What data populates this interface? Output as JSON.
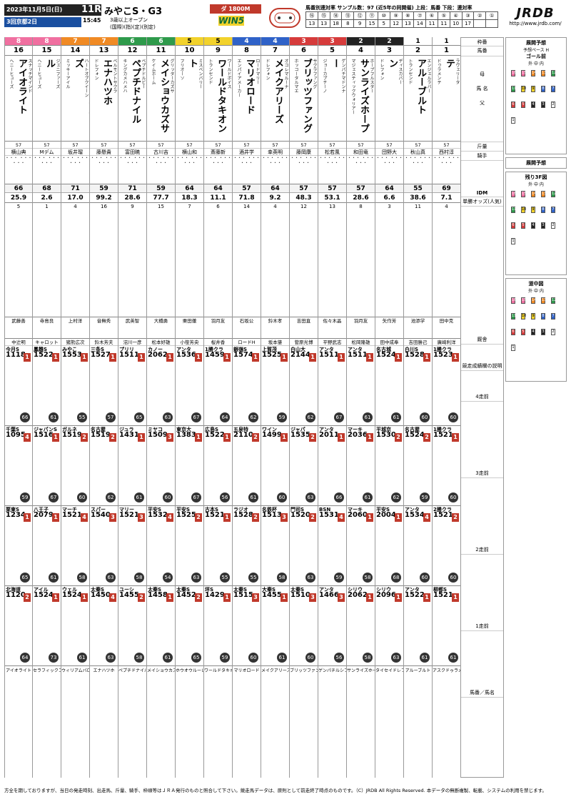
{
  "header": {
    "date": "2023年11月5日(日)",
    "race_num": "11R",
    "race_name": "みやこS・G3",
    "meeting": "3回京都2日",
    "time": "15:45",
    "cond1": "3歳以上オープン",
    "cond2": "(国際)(指)(定)(別定)",
    "course": "ダ 1800M",
    "win5": "WIN5",
    "stats": "馬番別連対率 サンプル数：97 (近5年の同開催) 上段：馬番 下段：連対率",
    "num_row": [
      "⑯",
      "⑮",
      "⑭",
      "⑬",
      "⑫",
      "⑪",
      "⑩",
      "⑨",
      "⑧",
      "⑦",
      "⑥",
      "⑤",
      "④",
      "③",
      "②",
      "①"
    ],
    "rate_row": [
      "13",
      "13",
      "18",
      "8",
      "9",
      "15",
      "5",
      "12",
      "13",
      "14",
      "11",
      "11",
      "10",
      "17",
      "",
      ""
    ],
    "logo": "JRDB",
    "url": "http://www.jrdb.com/"
  },
  "horses": [
    {
      "waku": "8",
      "umaban": "16",
      "name": "アイオライト",
      "sire": "ヘニーヒューズ",
      "dam": "スナッチマインド",
      "jockey": "横山典",
      "weight": "57",
      "idx": "66",
      "odds": "25.9",
      "pop": "5",
      "trainer": "武藤善",
      "owner": "中辻明",
      "past": [
        {
          "t": "今月S",
          "r": "1118",
          "pos": "1",
          "idm": "66"
        },
        {
          "t": "千葉S",
          "r": "1095",
          "pos": "4",
          "idm": "59"
        },
        {
          "t": "栗東S",
          "r": "1234",
          "pos": "1",
          "idm": "65"
        },
        {
          "t": "北海道",
          "r": "1120",
          "pos": "2",
          "idm": "64"
        }
      ]
    },
    {
      "waku": "8",
      "umaban": "15",
      "name": "セラフィックコール",
      "sire": "ヘニーヒューズ",
      "dam": "ジェニファーズ",
      "jockey": "Mデム",
      "weight": "57",
      "idx": "68",
      "odds": "2.6",
      "pop": "1",
      "trainer": "寺島良",
      "owner": "キャロット",
      "past": [
        {
          "t": "鳳雛S",
          "r": "1522",
          "pos": "1",
          "idm": "61"
        },
        {
          "t": "ジャパンS",
          "r": "1516",
          "pos": "1",
          "idm": "67"
        },
        {
          "t": "八王子",
          "r": "2079",
          "pos": "1",
          "idm": "61"
        },
        {
          "t": "アイル",
          "r": "1524",
          "pos": "1",
          "idm": "73"
        }
      ]
    },
    {
      "waku": "7",
      "umaban": "14",
      "name": "ウィリアムバローズ",
      "sire": "ミッキーアイル",
      "dam": "ハートオブクイーン",
      "jockey": "坂井瑠",
      "weight": "57",
      "idx": "71",
      "odds": "17.0",
      "pop": "4",
      "trainer": "上村洋",
      "owner": "猪熊広次",
      "past": [
        {
          "t": "みやこ",
          "r": "1553",
          "pos": "1",
          "idm": "55"
        },
        {
          "t": "ガルネ",
          "r": "1519",
          "pos": "2",
          "idm": "60"
        },
        {
          "t": "マーチ",
          "r": "1521",
          "pos": "4",
          "idm": "58"
        },
        {
          "t": "ウェル",
          "r": "1524",
          "pos": "1",
          "idm": "61"
        }
      ]
    },
    {
      "waku": "7",
      "umaban": "13",
      "name": "エナハツホ",
      "sire": "ドレフォン",
      "dam": "ベルモントサクラ",
      "jockey": "藤懸貴",
      "weight": "57",
      "idx": "59",
      "odds": "99.2",
      "pop": "16",
      "trainer": "音無秀",
      "owner": "鈴木芳夫",
      "past": [
        {
          "t": "三条S",
          "r": "1527",
          "pos": "1",
          "idm": "57"
        },
        {
          "t": "名古屋",
          "r": "1519",
          "pos": "2",
          "idm": "62"
        },
        {
          "t": "スパー",
          "r": "1540",
          "pos": "3",
          "idm": "63"
        },
        {
          "t": "太秦S",
          "r": "1450",
          "pos": "4",
          "idm": "63"
        }
      ]
    },
    {
      "waku": "6",
      "umaban": "12",
      "name": "ペプチドナイル",
      "sire": "キングカメハメハ",
      "dam": "ペプチドルビー",
      "jockey": "富田暁",
      "weight": "57",
      "idx": "71",
      "odds": "28.6",
      "pop": "9",
      "trainer": "武英智",
      "owner": "沼川一彦",
      "past": [
        {
          "t": "プリリ",
          "r": "1511",
          "pos": "1",
          "idm": "65"
        },
        {
          "t": "ジュラ",
          "r": "1431",
          "pos": "1",
          "idm": "61"
        },
        {
          "t": "マリー",
          "r": "1521",
          "pos": "3",
          "idm": "58"
        },
        {
          "t": "ユーシ",
          "r": "1455",
          "pos": "2",
          "idm": "58"
        }
      ]
    },
    {
      "waku": "6",
      "umaban": "11",
      "name": "メイショウカズサ",
      "sire": "ケイムホーム",
      "dam": "グリッターカズサ",
      "jockey": "古川吉",
      "weight": "57",
      "idx": "59",
      "odds": "77.7",
      "pop": "15",
      "trainer": "大橋勇",
      "owner": "松本好雄",
      "past": [
        {
          "t": "カノー",
          "r": "2062",
          "pos": "1",
          "idm": "63"
        },
        {
          "t": "ミヤコ",
          "r": "1509",
          "pos": "3",
          "idm": "60"
        },
        {
          "t": "平安S",
          "r": "1532",
          "pos": "4",
          "idm": "54"
        },
        {
          "t": "太秦S",
          "r": "1458",
          "pos": "1",
          "idm": "61"
        }
      ]
    },
    {
      "waku": "5",
      "umaban": "10",
      "name": "ホウオウルーレット",
      "sire": "フリオーソ",
      "dam": "ミスペンバリー",
      "jockey": "横山和",
      "weight": "57",
      "idx": "64",
      "odds": "18.3",
      "pop": "7",
      "trainer": "栗田徹",
      "owner": "小笹芳央",
      "past": [
        {
          "t": "アンタ",
          "r": "1536",
          "pos": "1",
          "idm": "67"
        },
        {
          "t": "東京大",
          "r": "1383",
          "pos": "1",
          "idm": "67"
        },
        {
          "t": "平安S",
          "r": "1525",
          "pos": "2",
          "idm": "63"
        },
        {
          "t": "太秦S",
          "r": "1452",
          "pos": "2",
          "idm": "65"
        }
      ]
    },
    {
      "waku": "5",
      "umaban": "9",
      "name": "ワールドタキオン",
      "sire": "トランセンド",
      "dam": "ワールドボイス",
      "jockey": "斎藤新",
      "weight": "57",
      "idx": "64",
      "odds": "11.1",
      "pop": "6",
      "trainer": "羽月友",
      "owner": "桜井香",
      "past": [
        {
          "t": "1勝クラ",
          "r": "1459",
          "pos": "1",
          "idm": "64"
        },
        {
          "t": "広島S",
          "r": "1522",
          "pos": "1",
          "idm": "56"
        },
        {
          "t": "古本S",
          "r": "1521",
          "pos": "1",
          "idm": "55"
        },
        {
          "t": "坪S",
          "r": "1429",
          "pos": "1",
          "idm": "59"
        }
      ]
    },
    {
      "waku": "4",
      "umaban": "8",
      "name": "マリオロード",
      "sire": "エンパイアメーカー",
      "dam": "ロードマリー",
      "jockey": "酒井学",
      "weight": "57",
      "idx": "57",
      "odds": "71.8",
      "pop": "14",
      "trainer": "石坂公",
      "owner": "ロードH",
      "past": [
        {
          "t": "銀嶺S",
          "r": "1574",
          "pos": "1",
          "idm": "62"
        },
        {
          "t": "五泉特",
          "r": "2110",
          "pos": "2",
          "idm": "61"
        },
        {
          "t": "ラジオ",
          "r": "1528",
          "pos": "2",
          "idm": "55"
        },
        {
          "t": "太秦S",
          "r": "1515",
          "pos": "3",
          "idm": "60"
        }
      ]
    },
    {
      "waku": "4",
      "umaban": "7",
      "name": "メイクアリーズ",
      "sire": "ドレフォン",
      "dam": "オコレマルーナ",
      "jockey": "幸英明",
      "weight": "57",
      "idx": "64",
      "odds": "9.2",
      "pop": "4",
      "trainer": "鈴木孝",
      "owner": "坂本肇",
      "past": [
        {
          "t": "上賀茂",
          "r": "1525",
          "pos": "1",
          "idm": "59"
        },
        {
          "t": "ワイン",
          "r": "1499",
          "pos": "1",
          "idm": "60"
        },
        {
          "t": "名鉄杯",
          "r": "1513",
          "pos": "3",
          "idm": "58"
        },
        {
          "t": "大秦S",
          "r": "1455",
          "pos": "1",
          "idm": "61"
        }
      ]
    },
    {
      "waku": "3",
      "umaban": "6",
      "name": "ブリッツファング",
      "sire": "ホッコータルマエ",
      "dam": "サクラファング",
      "jockey": "藤岡康",
      "weight": "57",
      "idx": "57",
      "odds": "48.3",
      "pop": "12",
      "trainer": "吉田直",
      "owner": "菅原光博",
      "past": [
        {
          "t": "白山大",
          "r": "2144",
          "pos": "1",
          "idm": "62"
        },
        {
          "t": "ジャパ",
          "r": "1535",
          "pos": "2",
          "idm": "63"
        },
        {
          "t": "門司S",
          "r": "1520",
          "pos": "2",
          "idm": "63"
        },
        {
          "t": "太秦S",
          "r": "1510",
          "pos": "3",
          "idm": "60"
        }
      ]
    },
    {
      "waku": "3",
      "umaban": "5",
      "name": "ゲンパチルシファー",
      "sire": "ジョーカプチーノ",
      "dam": "ゲンパチマドンナ",
      "jockey": "松若風",
      "weight": "57",
      "idx": "57",
      "odds": "53.1",
      "pop": "13",
      "trainer": "佐々木晶",
      "owner": "平野武志",
      "past": [
        {
          "t": "アンタ",
          "r": "1511",
          "pos": "1",
          "idm": "67"
        },
        {
          "t": "アンタ",
          "r": "2011",
          "pos": "1",
          "idm": "66"
        },
        {
          "t": "BSN",
          "r": "1531",
          "pos": "4",
          "idm": "59"
        },
        {
          "t": "アンタ",
          "r": "1466",
          "pos": "3",
          "idm": "56"
        }
      ]
    },
    {
      "waku": "2",
      "umaban": "4",
      "name": "サンライズホープ",
      "sire": "マジェスティックウォリアー",
      "dam": "ホープフルスター",
      "jockey": "和田竜",
      "weight": "57",
      "idx": "57",
      "odds": "28.6",
      "pop": "8",
      "trainer": "羽月友",
      "owner": "松岡隆雄",
      "past": [
        {
          "t": "アンタ",
          "r": "1511",
          "pos": "1",
          "idm": "61"
        },
        {
          "t": "マーキ",
          "r": "2036",
          "pos": "1",
          "idm": "61"
        },
        {
          "t": "マーキ",
          "r": "2060",
          "pos": "1",
          "idm": "58"
        },
        {
          "t": "シリウ",
          "r": "2062",
          "pos": "1",
          "idm": "58"
        }
      ]
    },
    {
      "waku": "2",
      "umaban": "3",
      "name": "タイセイドレフォン",
      "sire": "ドレフォン",
      "dam": "ディスカバー",
      "jockey": "団野大",
      "weight": "57",
      "idx": "64",
      "odds": "6.6",
      "pop": "3",
      "trainer": "矢作芳",
      "owner": "田中成奉",
      "past": [
        {
          "t": "名古城",
          "r": "1524",
          "pos": "1",
          "idm": "61"
        },
        {
          "t": "平城京",
          "r": "1530",
          "pos": "2",
          "idm": "62"
        },
        {
          "t": "平安S",
          "r": "2004",
          "pos": "1",
          "idm": "68"
        },
        {
          "t": "シリウ",
          "r": "2096",
          "pos": "1",
          "idm": "63"
        }
      ]
    },
    {
      "waku": "1",
      "umaban": "2",
      "name": "アルーブルト",
      "sire": "トランセンド",
      "dam": "エンジェルラバー",
      "jockey": "秋山真",
      "weight": "57",
      "idx": "55",
      "odds": "38.6",
      "pop": "11",
      "trainer": "池添学",
      "owner": "吉田勝己",
      "past": [
        {
          "t": "白川S",
          "r": "1528",
          "pos": "1",
          "idm": "60"
        },
        {
          "t": "名古屋",
          "r": "1524",
          "pos": "2",
          "idm": "59"
        },
        {
          "t": "アンタ",
          "r": "1534",
          "pos": "4",
          "idm": "60"
        },
        {
          "t": "アンタ",
          "r": "1522",
          "pos": "1",
          "idm": "61"
        }
      ]
    },
    {
      "waku": "1",
      "umaban": "1",
      "name": "アスクドゥラメンテ",
      "sire": "ドゥラメンテ",
      "dam": "ラヴェリータ",
      "jockey": "西村淳",
      "weight": "57",
      "idx": "69",
      "odds": "7.1",
      "pop": "4",
      "trainer": "田中克",
      "owner": "廣崎利洋",
      "past": [
        {
          "t": "1勝クラ",
          "r": "1523",
          "pos": "1",
          "idm": "60"
        },
        {
          "t": "1勝クラ",
          "r": "1521",
          "pos": "1",
          "idm": "60"
        },
        {
          "t": "2勝クラ",
          "r": "1521",
          "pos": "2",
          "idm": "60"
        },
        {
          "t": "柳都S",
          "r": "1521",
          "pos": "1",
          "idm": "61"
        }
      ]
    }
  ],
  "legend": {
    "waku": "枠番",
    "umaban": "馬番",
    "name_head": "馬 名",
    "sire": "父",
    "dam": "母",
    "weight_head": "斤量",
    "jockey_head": "騎手",
    "idm_head": "IDM",
    "odds_head": "単勝オッズ(人気)",
    "trainer_head": "厩舎",
    "past4": "4走前",
    "past3": "3走前",
    "past2": "2走前",
    "past1": "1走前",
    "races_head": "競走成績欄の説明",
    "bottom": "馬番／馬名"
  },
  "side": {
    "pace_title": "展開予想",
    "pace_sub": "予想ペース H",
    "goal": "ゴール前",
    "mid": "道中図",
    "last3f": "残り3F図",
    "out_in": "外 中 内"
  },
  "footer": "方全を期しておりますが、当日の発走時刻、出走馬、斤量、騎手、枠順等はＪＲＡ発行のものと照合して下さい。競走馬データは、原則として前走終了時点のものです。（C）JRDB All Rights Reserved. 本データの無断複製、転載、システムの利用を禁じます。"
}
